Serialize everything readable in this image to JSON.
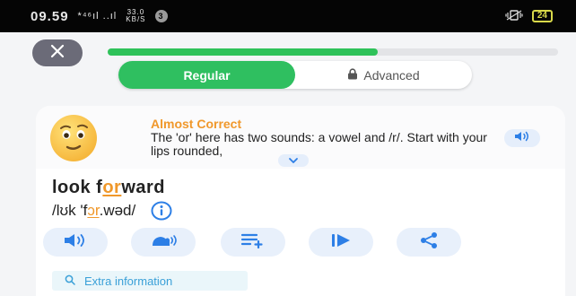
{
  "status_bar": {
    "time": "09.59",
    "network": "*⁴⁶ıl ..ıl",
    "speed_top": "33.0",
    "speed_bottom": "KB/S",
    "notification_count": "3",
    "battery": "24"
  },
  "lesson": {
    "progress_fraction": 0.6
  },
  "tabs": [
    {
      "label": "Regular",
      "active": true
    },
    {
      "label": "Advanced",
      "active": false,
      "icon": "lock-icon"
    }
  ],
  "feedback": {
    "title": "Almost Correct",
    "text": "The 'or' here has two sounds: a vowel and /r/. Start with your lips rounded,",
    "emoji": "smiley-face"
  },
  "word": {
    "before": "look f",
    "highlight": "or",
    "after": "ward"
  },
  "ipa": {
    "before": "/lʊk 'f",
    "highlight": "ɔr",
    "after": ".wəd/"
  },
  "actions": [
    "speaker-icon",
    "slow-speaker-icon",
    "add-to-list-icon",
    "play-icon",
    "share-icon"
  ],
  "extra_info": {
    "label": "Extra information"
  },
  "colors": {
    "accent_green": "#2fbf60",
    "highlight_orange": "#f0982b",
    "icon_blue": "#2d7fe6"
  }
}
